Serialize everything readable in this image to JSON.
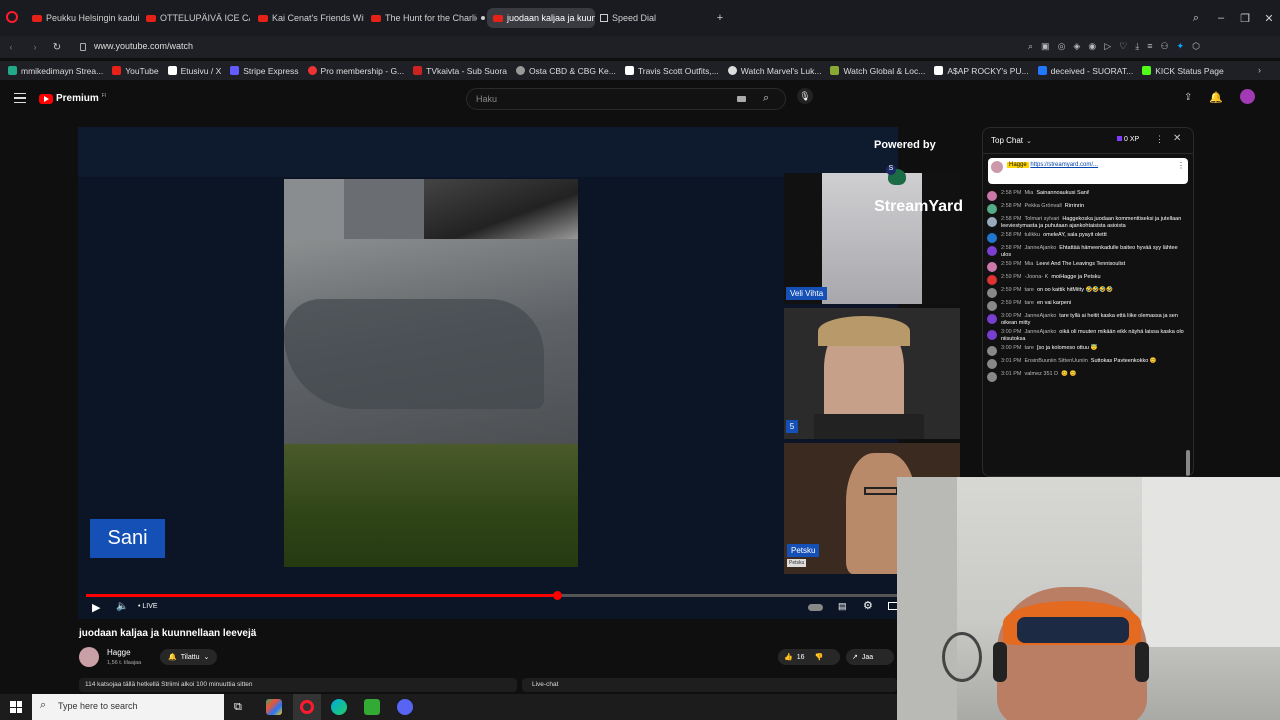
{
  "browser": {
    "tabs": [
      {
        "title": "Peukku Helsingin kaduill"
      },
      {
        "title": "OTTELUPÄIVÄ ICE CAGE 5"
      },
      {
        "title": "Kai Cenat's Friends Will B"
      },
      {
        "title": "The Hunt for the Charlie K"
      },
      {
        "title": "juodaan kaljaa ja kuunnel"
      },
      {
        "title": "Speed Dial"
      }
    ],
    "url": "www.youtube.com/watch",
    "bookmarks": [
      {
        "label": "mmikedimayn Strea...",
        "color": "#2a8"
      },
      {
        "label": "YouTube",
        "color": "#e62117"
      },
      {
        "label": "Etusivu / X",
        "color": "#fff"
      },
      {
        "label": "Stripe Express",
        "color": "#635bff"
      },
      {
        "label": "Pro membership - G...",
        "color": "#e33"
      },
      {
        "label": "TVkaivta - Sub Suora",
        "color": "#c22"
      },
      {
        "label": "Osta CBD & CBG Ke...",
        "color": "#999"
      },
      {
        "label": "Travis Scott Outfits,...",
        "color": "#fff"
      },
      {
        "label": "Watch Marvel's Luk...",
        "color": "#ddd"
      },
      {
        "label": "Watch Global & Loc...",
        "color": "#8a3"
      },
      {
        "label": "A$AP ROCKY's PU...",
        "color": "#fff"
      },
      {
        "label": "deceived - SUORAT...",
        "color": "#27f"
      },
      {
        "label": "KICK Status Page",
        "color": "#53fc18"
      }
    ]
  },
  "youtube": {
    "logo": "Premium",
    "logo_region": "FI",
    "search_placeholder": "Haku"
  },
  "player": {
    "powered_by": "Powered by",
    "streamyard": "StreamYard",
    "name_main": "Sani",
    "name_cam1": "Veli Vihta",
    "cam2_badge": "5",
    "name_cam3": "Petsku",
    "name_cam3_small": "Petsku",
    "live_label": "• LIVE",
    "progress": 0.58
  },
  "video": {
    "title": "juodaan kaljaa ja kuunnellaan leevejä",
    "channel": "Hagge",
    "subs": "1,56 t. tilaajaa",
    "subscribe": "Tilattu",
    "likes": "16",
    "share": "Jaa",
    "viewers": "114 katsojaa tällä hetkellä  Striimi alkoi 100 minuuttia sitten",
    "livechat": "Live-chat"
  },
  "chat": {
    "mode": "Top Chat",
    "xp": "0 XP",
    "pinned": {
      "author": "Hagge",
      "text": "https://streamyard.com/..."
    },
    "messages": [
      {
        "time": "2:58 PM",
        "author": "Mia",
        "text": "Sainannoaukusi Sani!"
      },
      {
        "time": "2:58 PM",
        "author": "Pekka Grönvall",
        "text": "Rirrinrin"
      },
      {
        "time": "2:58 PM",
        "author": "Tolmari sylvari",
        "text": "Haggekoska juodaan kommenttiseksi ja jutellaan leeviestymasta ja puhutaan ajankohtaisista asioista"
      },
      {
        "time": "2:58 PM",
        "author": "tulikku",
        "text": "omeleAY, sala pyayit olettt"
      },
      {
        "time": "2:58 PM",
        "author": "JanneAjanko",
        "text": "Ehtattää hämeenkadulle baiteo hyvää syy lähtee ulos"
      },
      {
        "time": "2:59 PM",
        "author": "Mia",
        "text": "Leevi And The Leavings Tennisoulist"
      },
      {
        "time": "2:59 PM",
        "author": "-Joona- K",
        "text": "moiHagge ja Petsku"
      },
      {
        "time": "2:59 PM",
        "author": "tare",
        "text": "on oo kattik hitMitty 🤣🤣🤣🤣"
      },
      {
        "time": "2:59 PM",
        "author": "tare",
        "text": "en vai karpeni"
      },
      {
        "time": "3:00 PM",
        "author": "JanneAjanko",
        "text": "tare tyllä ai heitit kaska että liike olemassa ja sen oikean mitty"
      },
      {
        "time": "3:00 PM",
        "author": "JanneAjanko",
        "text": "oikä oli muuten mikään eikk näyhä laissa kaska olo niisutoksa"
      },
      {
        "time": "3:00 PM",
        "author": "tare",
        "text": "[so ja kolomeso ottuu 😇"
      },
      {
        "time": "3:01 PM",
        "author": "EnsinBuuniin SittenUuniin",
        "text": "Suttokas Pavteenkokko 😊"
      },
      {
        "time": "3:01 PM",
        "author": "valmez 351 D",
        "text": "😊 😊"
      }
    ]
  },
  "taskbar": {
    "search_placeholder": "Type here to search"
  }
}
